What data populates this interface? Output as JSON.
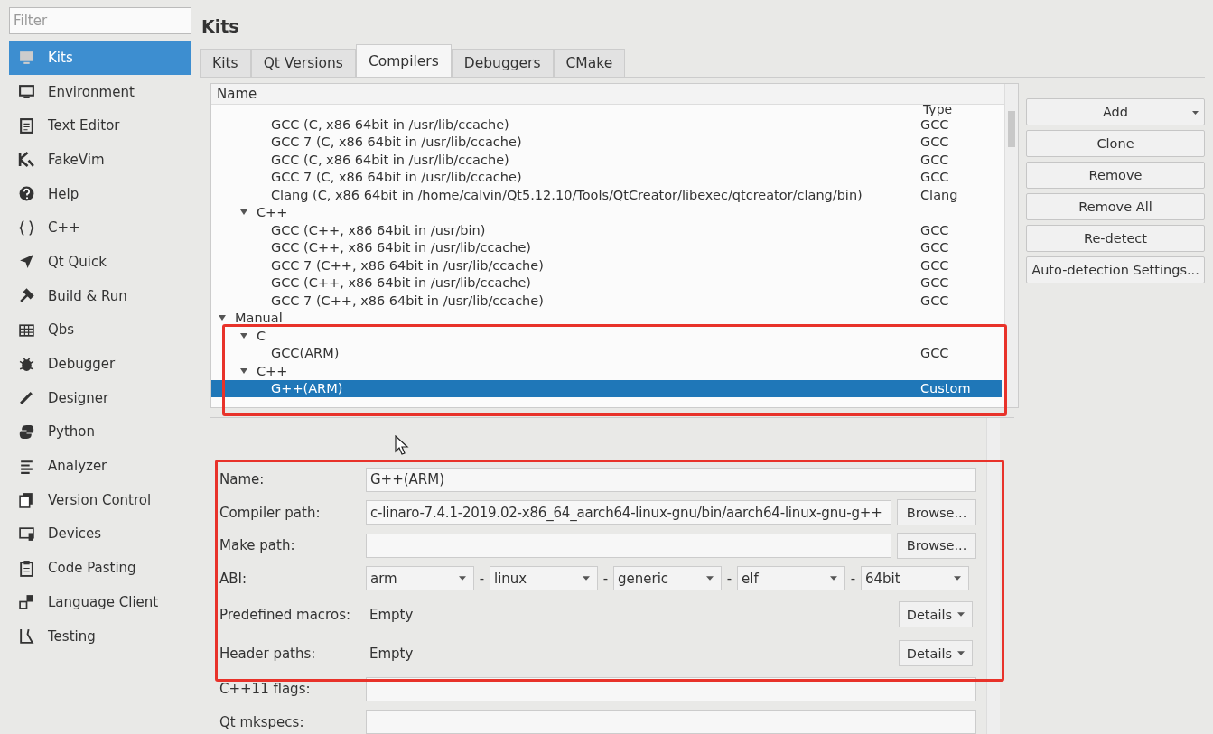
{
  "sidebar": {
    "filter_placeholder": "Filter",
    "items": [
      {
        "label": "Kits",
        "selected": true
      },
      {
        "label": "Environment",
        "selected": false
      },
      {
        "label": "Text Editor",
        "selected": false
      },
      {
        "label": "FakeVim",
        "selected": false
      },
      {
        "label": "Help",
        "selected": false
      },
      {
        "label": "C++",
        "selected": false
      },
      {
        "label": "Qt Quick",
        "selected": false
      },
      {
        "label": "Build & Run",
        "selected": false
      },
      {
        "label": "Qbs",
        "selected": false
      },
      {
        "label": "Debugger",
        "selected": false
      },
      {
        "label": "Designer",
        "selected": false
      },
      {
        "label": "Python",
        "selected": false
      },
      {
        "label": "Analyzer",
        "selected": false
      },
      {
        "label": "Version Control",
        "selected": false
      },
      {
        "label": "Devices",
        "selected": false
      },
      {
        "label": "Code Pasting",
        "selected": false
      },
      {
        "label": "Language Client",
        "selected": false
      },
      {
        "label": "Testing",
        "selected": false
      }
    ]
  },
  "page_title": "Kits",
  "tabs": [
    {
      "label": "Kits",
      "selected": false
    },
    {
      "label": "Qt Versions",
      "selected": false
    },
    {
      "label": "Compilers",
      "selected": true
    },
    {
      "label": "Debuggers",
      "selected": false
    },
    {
      "label": "CMake",
      "selected": false
    }
  ],
  "tree": {
    "columns": [
      "Name",
      "Type"
    ],
    "items": [
      {
        "kind": "continued",
        "children": [
          {
            "kind": "continued",
            "children": [
              {
                "kind": "leaf",
                "label": "GCC (C, x86 64bit in /usr/lib/ccache)",
                "type": "GCC",
                "selected": false
              },
              {
                "kind": "leaf",
                "label": "GCC 7 (C, x86 64bit in /usr/lib/ccache)",
                "type": "GCC",
                "selected": false
              },
              {
                "kind": "leaf",
                "label": "GCC (C, x86 64bit in /usr/lib/ccache)",
                "type": "GCC",
                "selected": false
              },
              {
                "kind": "leaf",
                "label": "GCC 7 (C, x86 64bit in /usr/lib/ccache)",
                "type": "GCC",
                "selected": false
              },
              {
                "kind": "leaf",
                "label": "Clang (C, x86 64bit in /home/calvin/Qt5.12.10/Tools/QtCreator/libexec/qtcreator/clang/bin)",
                "type": "Clang",
                "selected": false
              }
            ]
          },
          {
            "kind": "group",
            "label": "C++",
            "expanded": true,
            "children": [
              {
                "kind": "leaf",
                "label": "GCC (C++, x86 64bit in /usr/bin)",
                "type": "GCC",
                "selected": false
              },
              {
                "kind": "leaf",
                "label": "GCC (C++, x86 64bit in /usr/lib/ccache)",
                "type": "GCC",
                "selected": false
              },
              {
                "kind": "leaf",
                "label": "GCC 7 (C++, x86 64bit in /usr/lib/ccache)",
                "type": "GCC",
                "selected": false
              },
              {
                "kind": "leaf",
                "label": "GCC (C++, x86 64bit in /usr/lib/ccache)",
                "type": "GCC",
                "selected": false
              },
              {
                "kind": "leaf",
                "label": "GCC 7 (C++, x86 64bit in /usr/lib/ccache)",
                "type": "GCC",
                "selected": false
              }
            ]
          }
        ]
      },
      {
        "kind": "group",
        "label": "Manual",
        "expanded": true,
        "children": [
          {
            "kind": "group",
            "label": "C",
            "expanded": true,
            "children": [
              {
                "kind": "leaf",
                "label": "GCC(ARM)",
                "type": "GCC",
                "selected": false
              }
            ]
          },
          {
            "kind": "group",
            "label": "C++",
            "expanded": true,
            "children": [
              {
                "kind": "leaf",
                "label": "G++(ARM)",
                "type": "Custom",
                "selected": true
              }
            ]
          }
        ]
      }
    ]
  },
  "buttons": [
    {
      "label": "Add",
      "kind": "menu"
    },
    {
      "label": "Clone",
      "kind": "plain"
    },
    {
      "label": "Remove",
      "kind": "plain"
    },
    {
      "label": "Remove All",
      "kind": "plain"
    },
    {
      "label": "Re-detect",
      "kind": "plain"
    },
    {
      "label": "Auto-detection Settings...",
      "kind": "plain"
    }
  ],
  "form": [
    {
      "kind": "text",
      "label": "Name:",
      "value": "G++(ARM)"
    },
    {
      "kind": "path",
      "label": "Compiler path:",
      "value": "c-linaro-7.4.1-2019.02-x86_64_aarch64-linux-gnu/bin/aarch64-linux-gnu-g++",
      "button": "Browse..."
    },
    {
      "kind": "path",
      "label": "Make path:",
      "button": "Browse..."
    },
    {
      "kind": "abi",
      "label": "ABI:",
      "parts": [
        "arm",
        "linux",
        "generic",
        "elf",
        "64bit"
      ],
      "separator": "-"
    },
    {
      "kind": "details",
      "label": "Predefined macros:",
      "value": "Empty",
      "button": "Details"
    },
    {
      "kind": "details",
      "label": "Header paths:",
      "value": "Empty",
      "button": "Details"
    },
    {
      "kind": "text",
      "label": "C++11 flags:"
    },
    {
      "kind": "text",
      "label": "Qt mkspecs:"
    }
  ]
}
